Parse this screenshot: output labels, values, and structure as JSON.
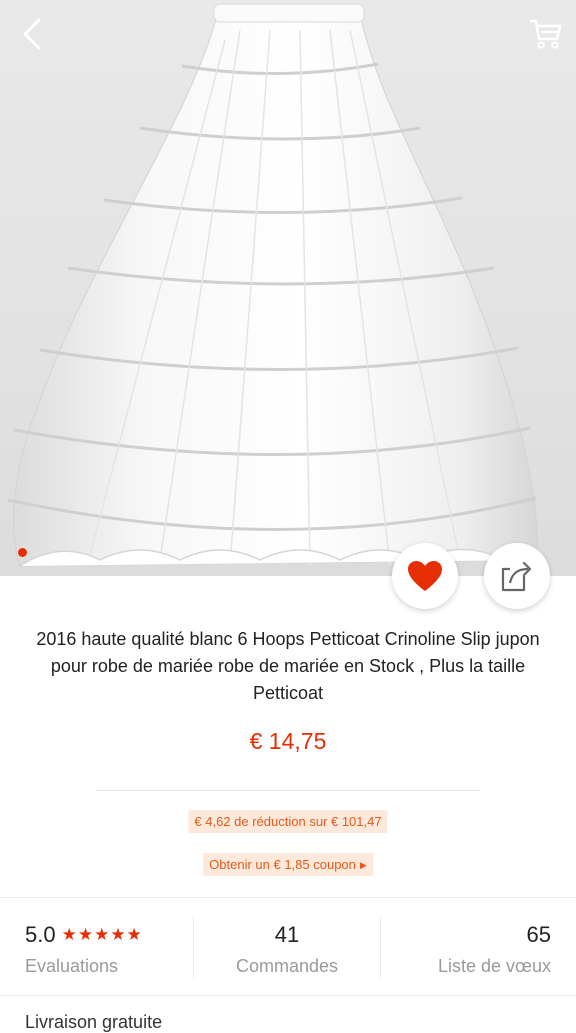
{
  "header": {
    "back_icon": "chevron-left-icon",
    "cart_icon": "shopping-cart-icon"
  },
  "gallery": {
    "image": "white hoop petticoat crinoline skirt",
    "active_dot_color": "#e62e04"
  },
  "actions": {
    "favorite_icon": "heart-icon",
    "favorite_color": "#e62e04",
    "share_icon": "share-icon"
  },
  "product": {
    "title": "2016 haute qualité blanc 6 Hoops Petticoat Crinoline Slip jupon pour robe de mariée robe de mariée en Stock , Plus la taille Petticoat",
    "price": "€ 14,75",
    "price_color": "#e62e04"
  },
  "promotions": {
    "discount": "€ 4,62 de réduction sur € 101,47",
    "coupon": "Obtenir un € 1,85 coupon",
    "coupon_arrow": "▶"
  },
  "stats": {
    "rating": "5.0",
    "stars": "★★★★★",
    "rating_label": "Evaluations",
    "orders": "41",
    "orders_label": "Commandes",
    "wishlist": "65",
    "wishlist_label": "Liste de vœux"
  },
  "shipping": {
    "label": "Livraison gratuite"
  }
}
